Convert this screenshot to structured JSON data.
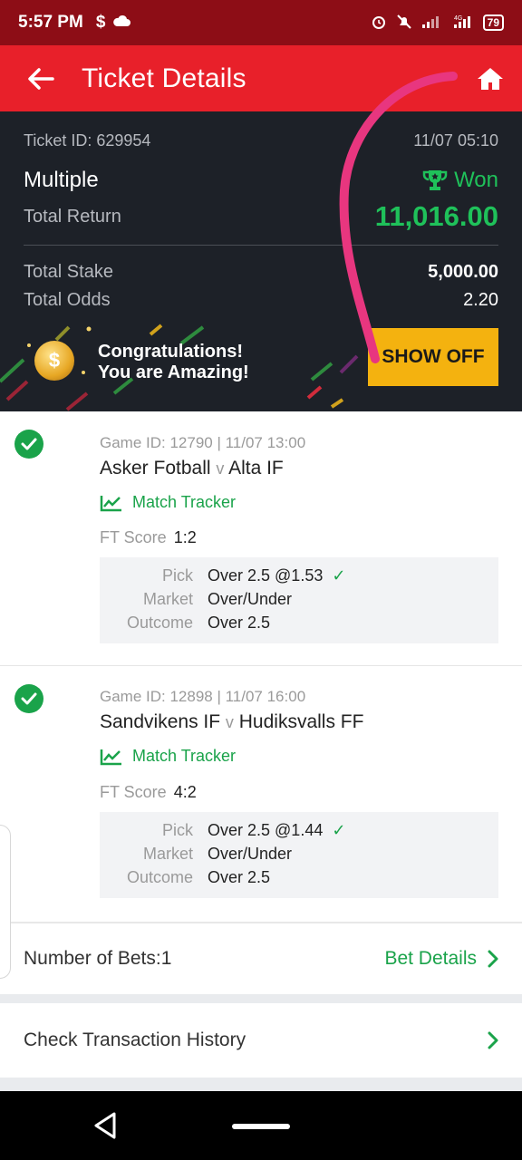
{
  "status_bar": {
    "time": "5:57 PM",
    "left_icons": [
      "dollar-icon",
      "cloud-icon"
    ],
    "right_icons": [
      "alarm-icon",
      "mute-icon",
      "signal-icon",
      "network-4g-icon"
    ],
    "battery": "79"
  },
  "header": {
    "title": "Ticket Details",
    "back_icon": "arrow-left-icon",
    "home_icon": "home-icon"
  },
  "ticket": {
    "id_label": "Ticket ID: 629954",
    "datetime": "11/07 05:10",
    "type": "Multiple",
    "status": "Won",
    "total_return_label": "Total Return",
    "total_return": "11,016.00",
    "total_stake_label": "Total Stake",
    "total_stake": "5,000.00",
    "total_odds_label": "Total Odds",
    "total_odds": "2.20"
  },
  "promo": {
    "line1": "Congratulations!",
    "line2": "You are Amazing!",
    "coin_symbol": "$",
    "button": "SHOW OFF"
  },
  "games": [
    {
      "meta": "Game ID: 12790 | 11/07 13:00",
      "home": "Asker Fotball",
      "vs": "v",
      "away": "Alta IF",
      "tracker": "Match Tracker",
      "score_label": "FT Score",
      "score": "1:2",
      "pick_label": "Pick",
      "pick": "Over 2.5 @1.53",
      "market_label": "Market",
      "market": "Over/Under",
      "outcome_label": "Outcome",
      "outcome": "Over 2.5"
    },
    {
      "meta": "Game ID: 12898 | 11/07 16:00",
      "home": "Sandvikens IF",
      "vs": "v",
      "away": "Hudiksvalls FF",
      "tracker": "Match Tracker",
      "score_label": "FT Score",
      "score": "4:2",
      "pick_label": "Pick",
      "pick": "Over 2.5 @1.44",
      "market_label": "Market",
      "market": "Over/Under",
      "outcome_label": "Outcome",
      "outcome": "Over 2.5"
    }
  ],
  "footer": {
    "bets_label": "Number of Bets:1",
    "bet_details": "Bet Details",
    "history": "Check Transaction History"
  },
  "colors": {
    "brand_red": "#e8202a",
    "status_red": "#8d0d16",
    "dark_panel": "#1d2128",
    "won_green": "#1fc15a",
    "accent_green": "#1aa34a",
    "button_yellow": "#f4b20f",
    "annotation_pink": "#e8367f"
  }
}
